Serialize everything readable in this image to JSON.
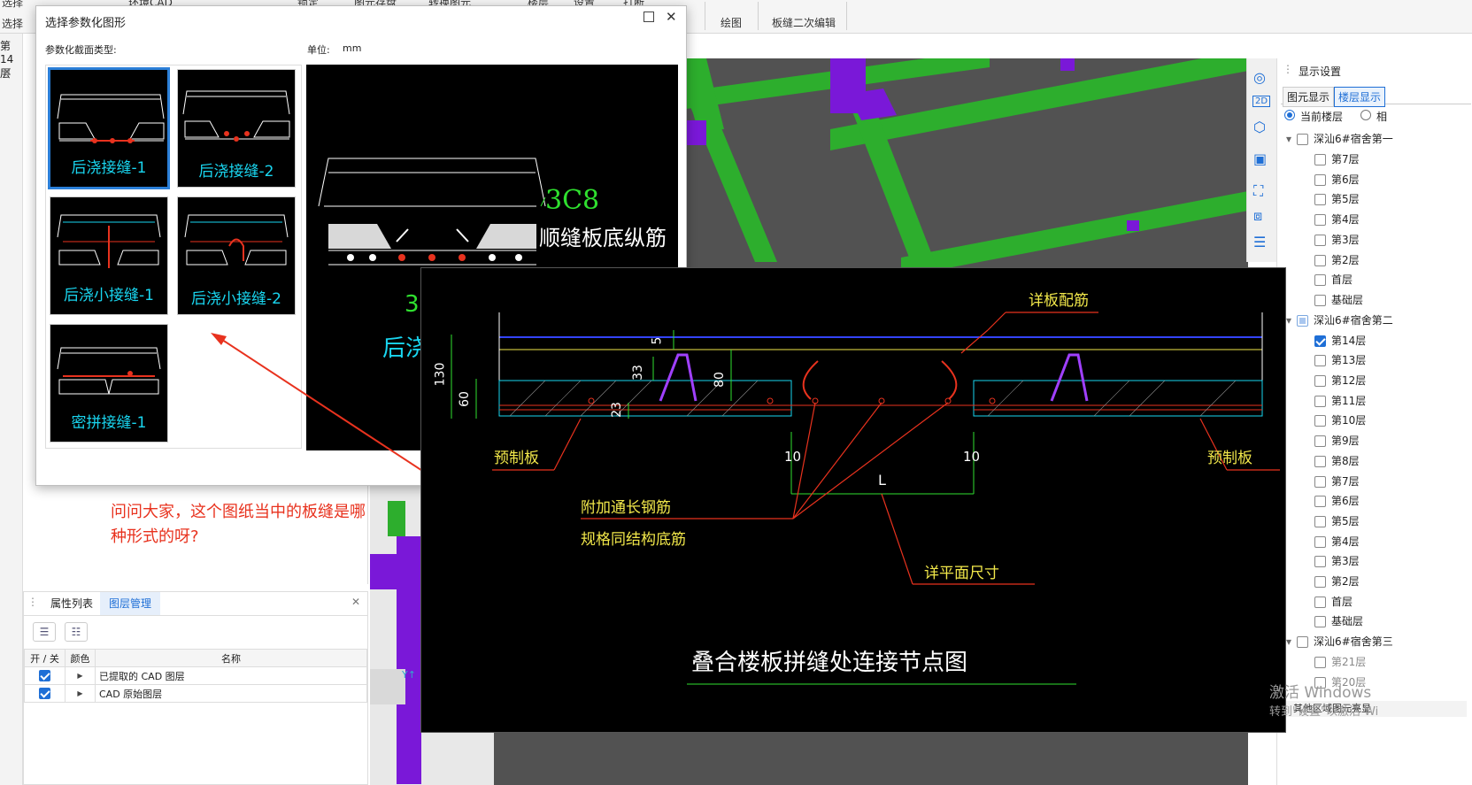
{
  "ribbon": {
    "items": [
      "选择",
      "环境CAD",
      "锁定",
      "图元存盘",
      "转换图元",
      "楼层",
      "设置",
      "打断",
      "绘图",
      "板缝二次编辑"
    ],
    "row2_left": "选择",
    "floor_label": "第14层"
  },
  "dialog": {
    "title": "选择参数化图形",
    "section_label": "参数化截面类型:",
    "unit_label": "单位:",
    "unit_value": "mm",
    "thumbs": [
      "后浇接缝-1",
      "后浇接缝-2",
      "后浇小接缝-1",
      "后浇小接缝-2",
      "密拼接缝-1"
    ],
    "preview": {
      "rebar_label": "3C8",
      "rebar_desc": "顺缝板底纵筋",
      "partial_num": "3",
      "partial_title": "后浇"
    }
  },
  "note": {
    "text": "问问大家，这个图纸当中的板缝是哪种形式的呀?"
  },
  "layer_panel": {
    "tabs": [
      "属性列表",
      "图层管理"
    ],
    "headers": [
      "开 / 关",
      "颜色",
      "名称"
    ],
    "rows": [
      {
        "name": "已提取的 CAD 图层"
      },
      {
        "name": "CAD 原始图层"
      }
    ]
  },
  "cad": {
    "top_label": "详板配筋",
    "left_label": "预制板",
    "right_label": "预制板",
    "note1": "附加通长钢筋",
    "note2": "规格同结构底筋",
    "dim_label": "详平面尺寸",
    "title": "叠合楼板拼缝处连接节点图",
    "dims": {
      "d130": "130",
      "d60": "60",
      "d5": "5",
      "d33": "33",
      "d80": "80",
      "d23": "23",
      "d10a": "10",
      "d10b": "10",
      "L": "L"
    }
  },
  "right_panel": {
    "title": "显示设置",
    "tabs": [
      "图元显示",
      "楼层显示"
    ],
    "radio1": "当前楼层",
    "radio2": "相",
    "groups": [
      {
        "name": "深汕6#宿舍第一",
        "floors": [
          "第7层",
          "第6层",
          "第5层",
          "第4层",
          "第3层",
          "第2层",
          "首层",
          "基础层"
        ]
      },
      {
        "name": "深汕6#宿舍第二",
        "floors": [
          "第14层",
          "第13层",
          "第12层",
          "第11层",
          "第10层",
          "第9层",
          "第8层",
          "第7层",
          "第6层",
          "第5层",
          "第4层",
          "第3层",
          "第2层",
          "首层",
          "基础层"
        ]
      },
      {
        "name": "深汕6#宿舍第三",
        "floors": [
          "第21层",
          "第20层"
        ]
      }
    ],
    "footer": "其他区域图元亮显"
  },
  "watermark": {
    "line1": "激活 Windows",
    "line2": "转到\"设置\"以激活 Wi"
  },
  "left_strip": {
    "partial_text": "选择"
  },
  "colors": {
    "cad_cyan": "#19d6f0",
    "cad_red": "#e8321e",
    "cad_yellow": "#f2e84a",
    "cad_green": "#2fe02f",
    "beam_green": "#2dae2d",
    "column_purple": "#7a18d8"
  }
}
